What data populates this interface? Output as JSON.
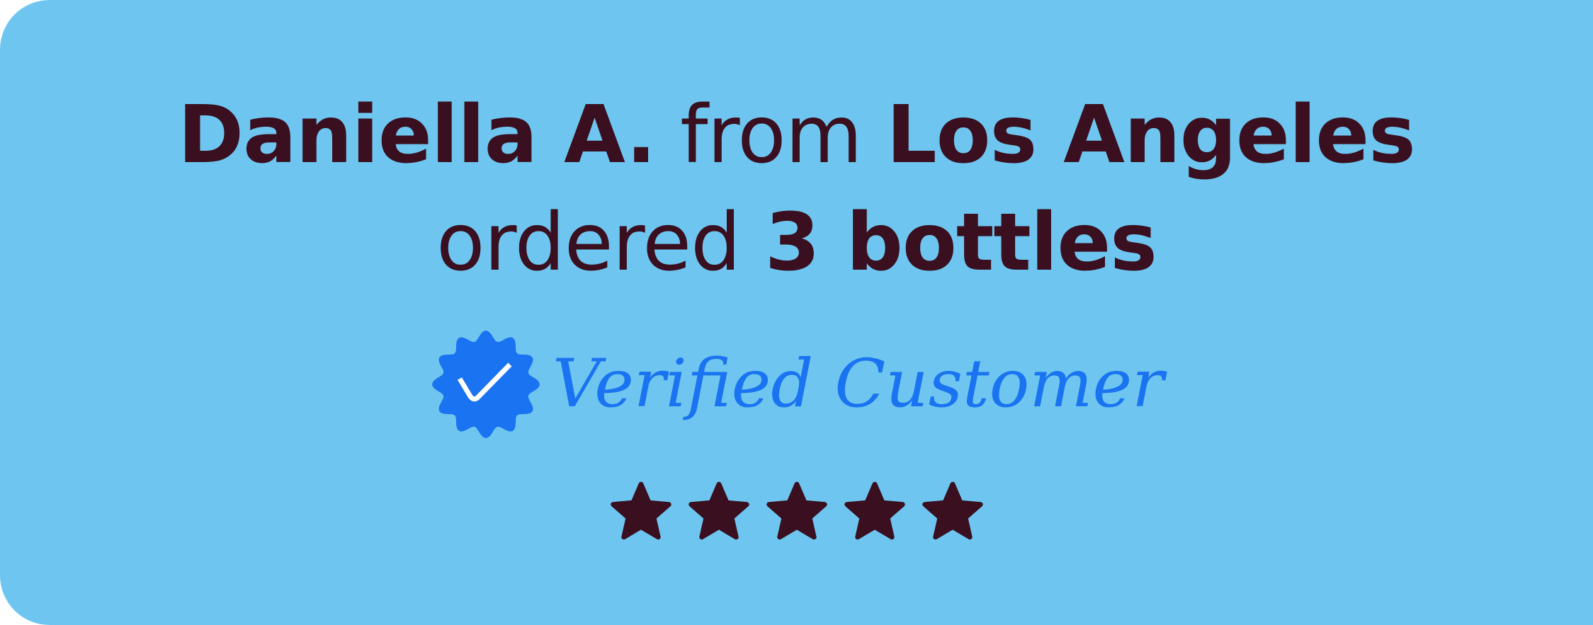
{
  "headline": {
    "name": "Daniella A.",
    "from_word": "from",
    "location": "Los Angeles",
    "ordered_word": "ordered",
    "quantity": "3 bottles"
  },
  "verified": {
    "icon": "verified-badge-icon",
    "label": "Verified Customer",
    "badge_color": "#1a73f0"
  },
  "rating": {
    "value": 5,
    "max": 5,
    "icon": "star-icon"
  },
  "colors": {
    "background": "#6ec6f0",
    "text": "#3a0f1f",
    "accent": "#1a73f0"
  }
}
